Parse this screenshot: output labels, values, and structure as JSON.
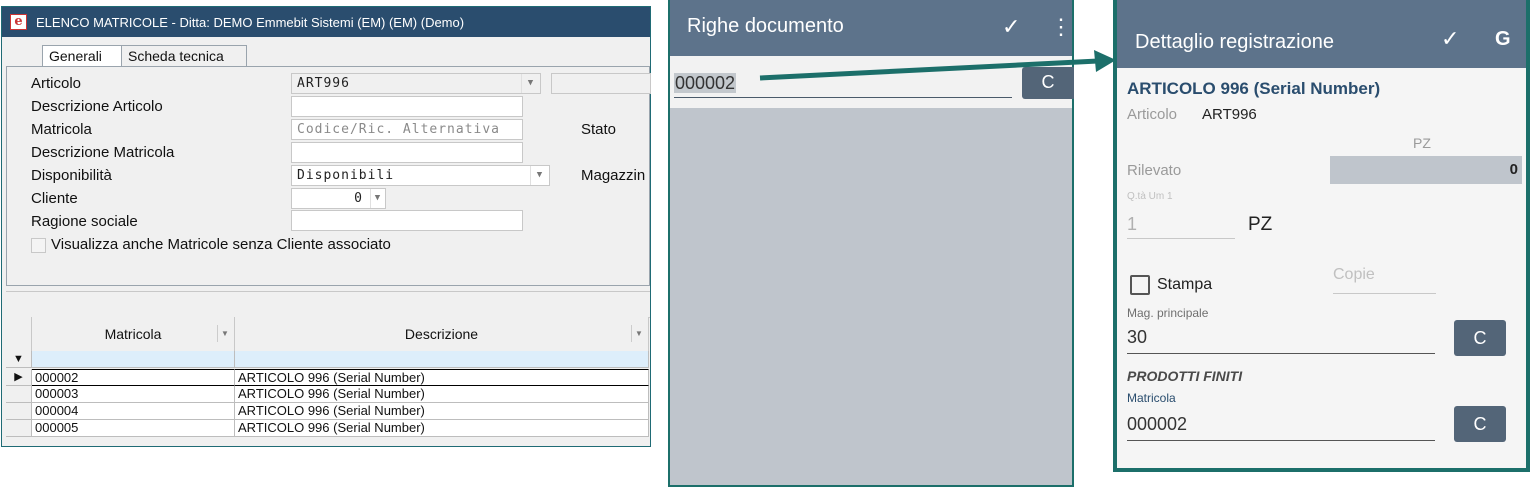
{
  "desktop": {
    "title": "ELENCO MATRICOLE - Ditta: DEMO Emmebit Sistemi (EM) (EM)  (Demo)",
    "tabs": [
      "Generali",
      "Scheda tecnica"
    ],
    "form": {
      "articolo_label": "Articolo",
      "articolo_value": "ART996",
      "descr_articolo_label": "Descrizione Articolo",
      "matricola_label": "Matricola",
      "matricola_placeholder": "Codice/Ric. Alternativa",
      "stato_label": "Stato",
      "descr_matricola_label": "Descrizione Matricola",
      "disponibilita_label": "Disponibilità",
      "disponibilita_value": "Disponibili",
      "magazzino_label": "Magazzin",
      "cliente_label": "Cliente",
      "cliente_value": "0",
      "ragione_label": "Ragione sociale",
      "checkbox_label": "Visualizza anche Matricole senza Cliente associato"
    },
    "grid": {
      "columns": [
        "Matricola",
        "Descrizione"
      ],
      "rows": [
        {
          "matricola": "000002",
          "descrizione": "ARTICOLO 996 (Serial Number)"
        },
        {
          "matricola": "000003",
          "descrizione": "ARTICOLO 996 (Serial Number)"
        },
        {
          "matricola": "000004",
          "descrizione": "ARTICOLO 996 (Serial Number)"
        },
        {
          "matricola": "000005",
          "descrizione": "ARTICOLO 996 (Serial Number)"
        }
      ]
    }
  },
  "mobile1": {
    "title": "Righe documento",
    "input_value": "000002",
    "clear_button": "C"
  },
  "mobile2": {
    "title": "Dettaglio registrazione",
    "g_button": "G",
    "article_title": "ARTICOLO 996 (Serial Number)",
    "articolo_label": "Articolo",
    "articolo_value": "ART996",
    "um_header": "PZ",
    "rilevato_label": "Rilevato",
    "rilevato_value": "0",
    "qta_label": "Q.tà Um 1",
    "qta_value": "1",
    "qta_um": "PZ",
    "stampa_label": "Stampa",
    "copie_placeholder": "Copie",
    "mag_label": "Mag. principale",
    "mag_value": "30",
    "mag_clear": "C",
    "section_title": "PRODOTTI FINITI",
    "matricola_label": "Matricola",
    "matricola_value": "000002",
    "matricola_clear": "C"
  },
  "colors": {
    "appbar": "#5d738b",
    "button": "#536578",
    "arrow": "#1c6f6a",
    "title_blue": "#2a4d6e"
  }
}
